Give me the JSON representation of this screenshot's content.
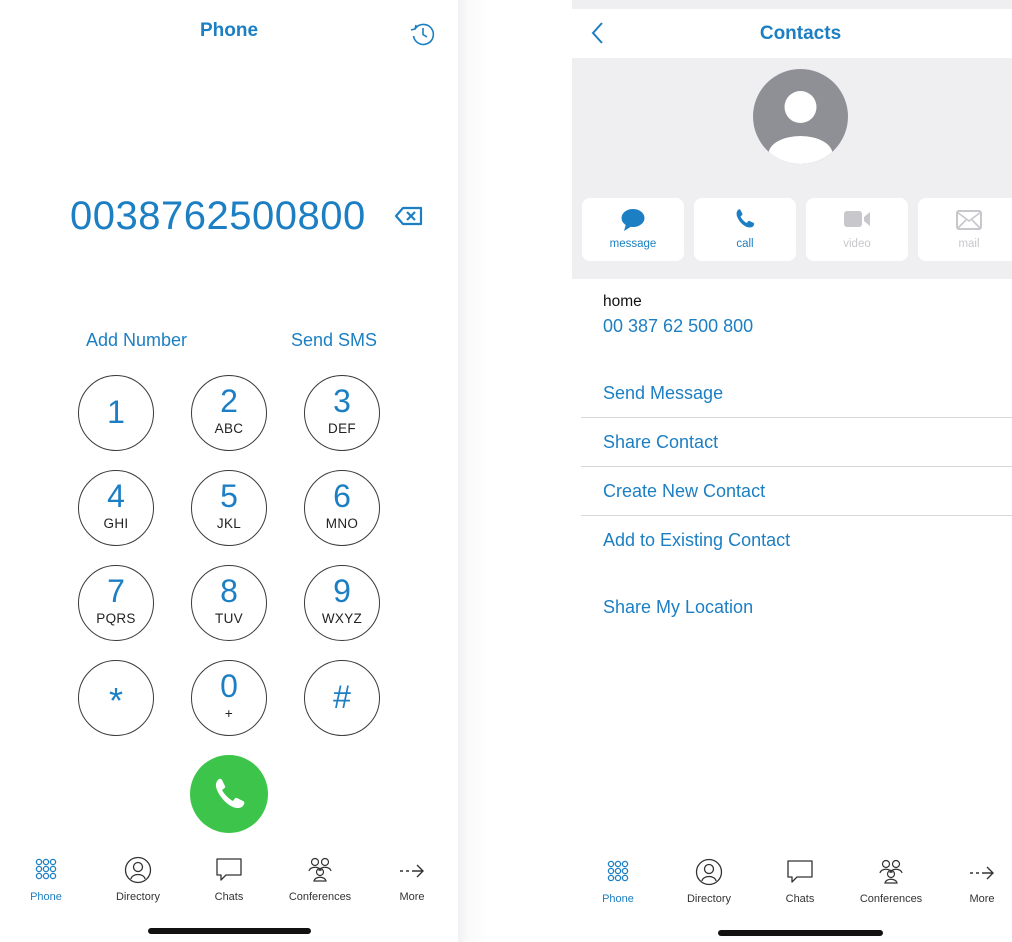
{
  "left": {
    "title": "Phone",
    "history_icon": "clock-history-icon",
    "dialed_number": "0038762500800",
    "backspace_icon": "backspace-icon",
    "add_number": "Add Number",
    "send_sms": "Send SMS",
    "keys": [
      {
        "digit": "1",
        "letters": ""
      },
      {
        "digit": "2",
        "letters": "ABC"
      },
      {
        "digit": "3",
        "letters": "DEF"
      },
      {
        "digit": "4",
        "letters": "GHI"
      },
      {
        "digit": "5",
        "letters": "JKL"
      },
      {
        "digit": "6",
        "letters": "MNO"
      },
      {
        "digit": "7",
        "letters": "PQRS"
      },
      {
        "digit": "8",
        "letters": "TUV"
      },
      {
        "digit": "9",
        "letters": "WXYZ"
      },
      {
        "digit": "*",
        "letters": ""
      },
      {
        "digit": "0",
        "letters": "+"
      },
      {
        "digit": "#",
        "letters": ""
      }
    ],
    "call_icon": "phone-icon",
    "call_color": "#3cc54a"
  },
  "tabs": [
    {
      "label": "Phone",
      "icon": "dialpad-icon",
      "active": true
    },
    {
      "label": "Directory",
      "icon": "person-icon",
      "active": false
    },
    {
      "label": "Chats",
      "icon": "chat-bubble-icon",
      "active": false
    },
    {
      "label": "Conferences",
      "icon": "group-icon",
      "active": false
    },
    {
      "label": "More",
      "icon": "arrow-right-icon",
      "active": false
    }
  ],
  "right": {
    "title": "Contacts",
    "back_icon": "chevron-left-icon",
    "avatar_icon": "avatar-placeholder-icon",
    "actions": [
      {
        "label": "message",
        "icon": "message-bubble-icon",
        "enabled": true
      },
      {
        "label": "call",
        "icon": "phone-icon",
        "enabled": true
      },
      {
        "label": "video",
        "icon": "video-camera-icon",
        "enabled": false
      },
      {
        "label": "mail",
        "icon": "mail-envelope-icon",
        "enabled": false
      }
    ],
    "phone_label": "home",
    "phone_value": "00 387 62 500 800",
    "menu": [
      "Send Message",
      "Share Contact",
      "Create New Contact",
      "Add to Existing Contact"
    ],
    "share_location": "Share My Location"
  },
  "colors": {
    "accent": "#1c7fc3",
    "call_green": "#3cc54a",
    "disabled": "#c7c7cc"
  }
}
